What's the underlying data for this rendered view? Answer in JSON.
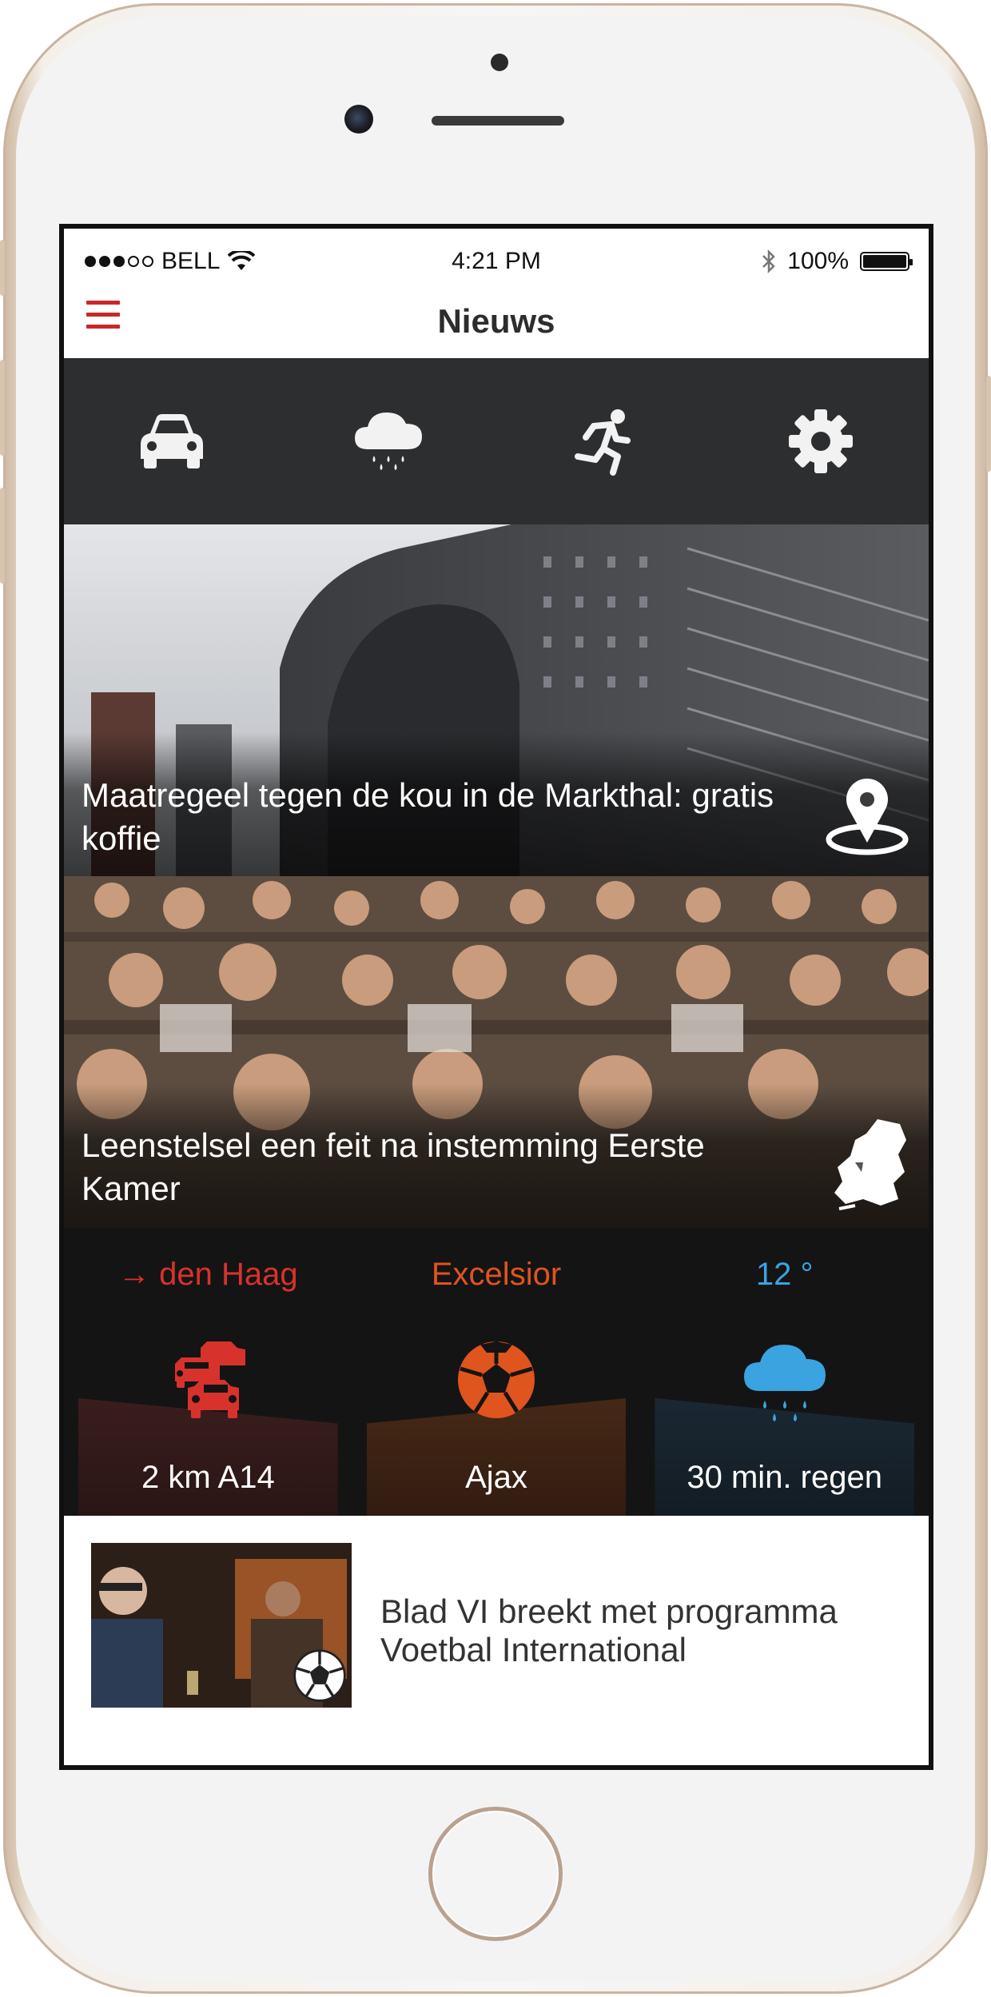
{
  "status_bar": {
    "carrier": "BELL",
    "signal_filled": 3,
    "signal_total": 5,
    "time": "4:21 PM",
    "battery": "100%",
    "battery_level": 1.0
  },
  "nav": {
    "title": "Nieuws",
    "menu_icon": "hamburger-icon"
  },
  "category_bar": {
    "items": [
      {
        "icon": "car-icon"
      },
      {
        "icon": "rain-cloud-icon"
      },
      {
        "icon": "runner-icon"
      },
      {
        "icon": "gear-icon"
      }
    ]
  },
  "stories": [
    {
      "title": "Maatregeel tegen de kou in de Markthal: gratis koffie",
      "icon": "location-pin-icon"
    },
    {
      "title": "Leenstelsel een feit na instemming Eerste Kamer",
      "icon": "netherlands-map-icon"
    }
  ],
  "widgets": [
    {
      "top": "→ den Haag",
      "icon": "traffic-cars-icon",
      "bottom": "2 km A14",
      "accent": "#d8322c"
    },
    {
      "top": "Excelsior",
      "icon": "soccer-ball-icon",
      "bottom": "Ajax",
      "accent": "#e0541e"
    },
    {
      "top": "12 °",
      "icon": "rain-cloud-icon",
      "bottom": "30 min. regen",
      "accent": "#3aa3e0"
    }
  ],
  "article": {
    "title": "Blad VI breekt met programma Voetbal International",
    "icon": "soccer-ball-icon"
  }
}
